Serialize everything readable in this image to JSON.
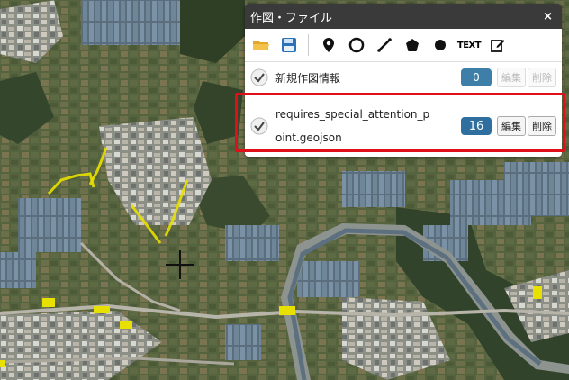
{
  "panel": {
    "title": "作図・ファイル",
    "close": "×"
  },
  "toolbar": {
    "text_label": "TEXT",
    "tools": [
      "open-folder-icon",
      "save-icon",
      "point-marker-icon",
      "circle-icon",
      "line-icon",
      "polygon-icon",
      "dot-icon",
      "text-tool",
      "edit-icon"
    ]
  },
  "layers": [
    {
      "name": "新規作図情報",
      "count": "0",
      "edit_label": "編集",
      "delete_label": "削除",
      "checked": true,
      "enabled": false
    },
    {
      "name_line1": "requires_special_attention_p",
      "name_line2": "oint.geojson",
      "count": "16",
      "edit_label": "編集",
      "delete_label": "削除",
      "checked": true,
      "enabled": true
    }
  ],
  "colors": {
    "header_bg": "#3a3a3a",
    "badge": "#2e6fa0",
    "highlight": "#e0101a",
    "track": "#e8e000"
  }
}
